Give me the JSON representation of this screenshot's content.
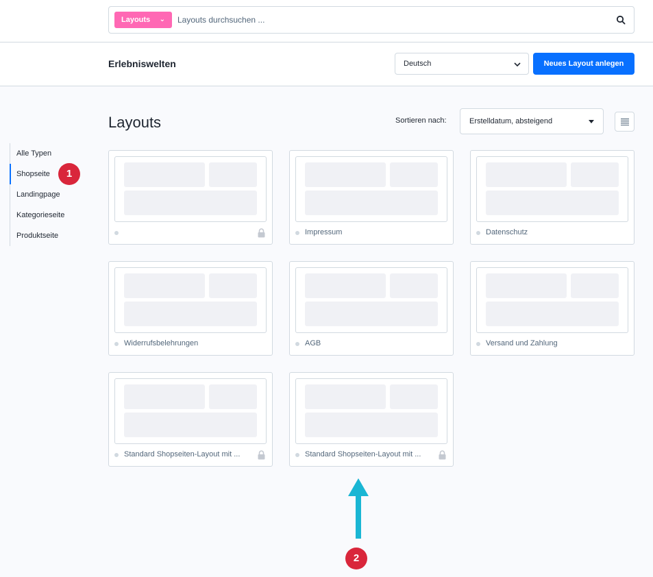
{
  "search": {
    "type_label": "Layouts",
    "placeholder": "Layouts durchsuchen ..."
  },
  "header": {
    "title": "Erlebniswelten",
    "language": "Deutsch",
    "new_button": "Neues Layout anlegen"
  },
  "main": {
    "title": "Layouts",
    "sort_label": "Sortieren nach:",
    "sort_value": "Erstelldatum, absteigend"
  },
  "sidebar": {
    "items": [
      {
        "label": "Alle Typen"
      },
      {
        "label": "Shopseite"
      },
      {
        "label": "Landingpage"
      },
      {
        "label": "Kategorieseite"
      },
      {
        "label": "Produktseite"
      }
    ]
  },
  "cards": [
    {
      "name": ""
    },
    {
      "name": "Impressum"
    },
    {
      "name": "Datenschutz"
    },
    {
      "name": "Widerrufsbelehrungen"
    },
    {
      "name": "AGB"
    },
    {
      "name": "Versand und Zahlung"
    },
    {
      "name": "Standard Shopseiten-Layout mit ..."
    },
    {
      "name": "Standard Shopseiten-Layout mit ..."
    }
  ],
  "annotations": {
    "marker_1": "1",
    "marker_2": "2"
  },
  "colors": {
    "accent": "#0870ff",
    "type_pill": "#ff68b4",
    "marker": "#d9263b",
    "arrow": "#1ab6d4"
  }
}
